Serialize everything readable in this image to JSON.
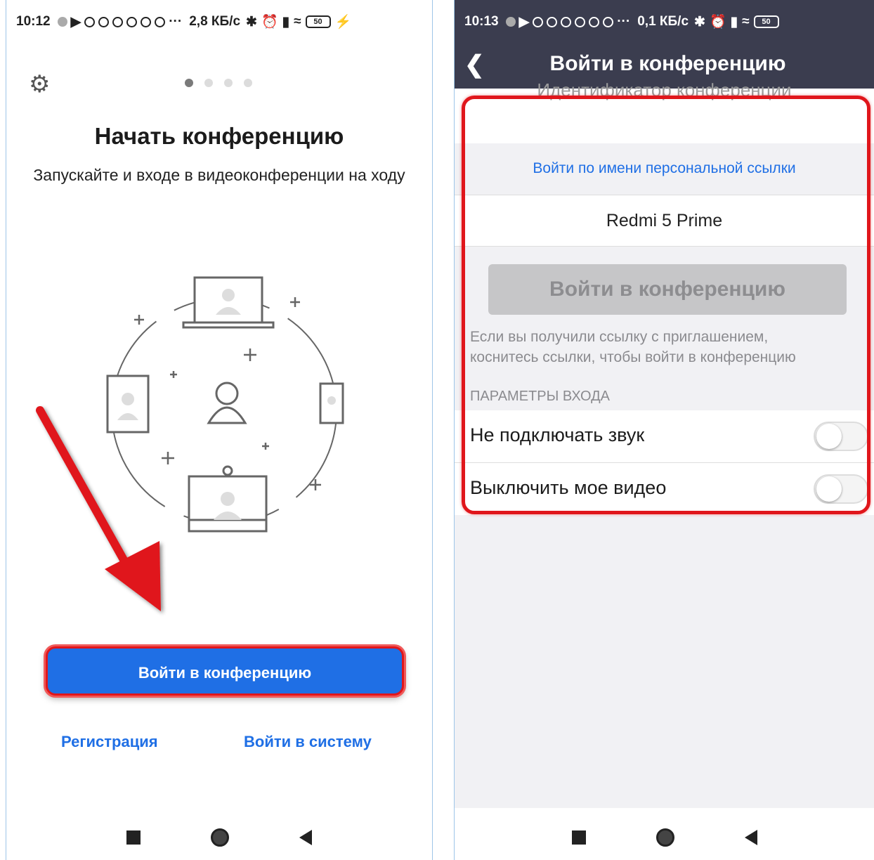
{
  "left": {
    "status": {
      "time": "10:12",
      "network": "2,8 КБ/с",
      "battery": "50"
    },
    "title": "Начать конференцию",
    "subtitle": "Запускайте и входе в видеоконференции на ходу",
    "join_button": "Войти в конференцию",
    "register_link": "Регистрация",
    "signin_link": "Войти в систему",
    "page_count": 4,
    "page_current": 1
  },
  "right": {
    "status": {
      "time": "10:13",
      "network": "0,1 КБ/с",
      "battery": "50"
    },
    "appbar": {
      "title": "Войти в конференцию"
    },
    "meeting_id_placeholder": "Идентификатор конференции",
    "personal_link_label": "Войти по имени персональной ссылки",
    "name_value": "Redmi 5 Prime",
    "join_button": "Войти в конференцию",
    "hint_line1": "Если вы получили ссылку с приглашением,",
    "hint_line2": "коснитесь ссылки, чтобы войти в конференцию",
    "section_title": "ПАРАМЕТРЫ ВХОДА",
    "options": [
      {
        "label": "Не подключать звук",
        "on": false
      },
      {
        "label": "Выключить мое видео",
        "on": false
      }
    ]
  },
  "colors": {
    "accent": "#1f6fe5",
    "highlight": "#e0161b",
    "header": "#3b3d4f"
  }
}
